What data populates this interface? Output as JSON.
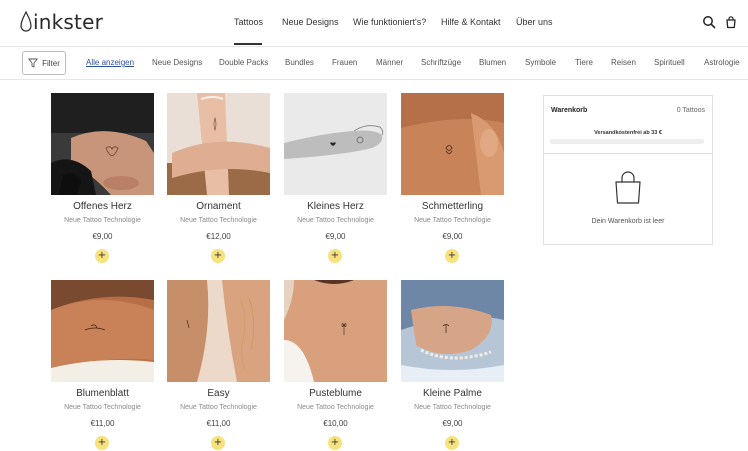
{
  "brand": {
    "name": "inkster"
  },
  "nav": [
    {
      "label": "Tattoos"
    },
    {
      "label": "Neue Designs"
    },
    {
      "label": "Wie funktioniert's?"
    },
    {
      "label": "Hilfe & Kontakt"
    },
    {
      "label": "Über uns"
    }
  ],
  "filter": {
    "label": "Filter"
  },
  "categories": [
    {
      "label": "Alle anzeigen"
    },
    {
      "label": "Neue Designs"
    },
    {
      "label": "Double Packs"
    },
    {
      "label": "Bundles"
    },
    {
      "label": "Frauen"
    },
    {
      "label": "Männer"
    },
    {
      "label": "Schriftzüge"
    },
    {
      "label": "Blumen"
    },
    {
      "label": "Symbole"
    },
    {
      "label": "Tiere"
    },
    {
      "label": "Reisen"
    },
    {
      "label": "Spirituell"
    },
    {
      "label": "Astrologie"
    }
  ],
  "products": [
    {
      "name": "Offenes Herz",
      "subtitle": "Neue Tattoo Technologie",
      "price": "€9,00"
    },
    {
      "name": "Ornament",
      "subtitle": "Neue Tattoo Technologie",
      "price": "€12,00"
    },
    {
      "name": "Kleines Herz",
      "subtitle": "Neue Tattoo Technologie",
      "price": "€9,00"
    },
    {
      "name": "Schmetterling",
      "subtitle": "Neue Tattoo Technologie",
      "price": "€9,00"
    },
    {
      "name": "Blumenblatt",
      "subtitle": "Neue Tattoo Technologie",
      "price": "€11,00"
    },
    {
      "name": "Easy",
      "subtitle": "Neue Tattoo Technologie",
      "price": "€11,00"
    },
    {
      "name": "Pusteblume",
      "subtitle": "Neue Tattoo Technologie",
      "price": "€10,00"
    },
    {
      "name": "Kleine Palme",
      "subtitle": "Neue Tattoo Technologie",
      "price": "€9,00"
    }
  ],
  "add_label": "+",
  "cart": {
    "title": "Warenkorb",
    "count": "0 Tattoos",
    "shipping_text": "Versandkostenfrei ab 33 €",
    "shipping_progress": 0,
    "empty_text": "Dein Warenkorb ist leer"
  },
  "colors": {
    "accent_yellow": "#f7e27e",
    "link_blue": "#2d4fa0",
    "text": "#333333"
  },
  "icons": [
    "search-icon",
    "cart-icon",
    "filter-icon",
    "shopping-bag-icon"
  ]
}
